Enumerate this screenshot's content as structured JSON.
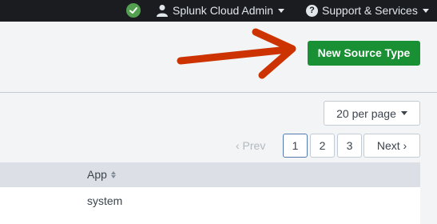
{
  "topbar": {
    "user_label": "Splunk Cloud Admin",
    "support_label": "Support & Services",
    "support_icon_glyph": "?",
    "status_color": "#53a051"
  },
  "header": {
    "new_source_type_label": "New Source Type",
    "button_color": "#1a9035"
  },
  "controls": {
    "per_page_label": "20 per page"
  },
  "pager": {
    "prev_label": "‹ Prev",
    "pages": [
      "1",
      "2",
      "3"
    ],
    "active_page": "1",
    "next_label": "Next ›"
  },
  "table": {
    "columns": [
      "App"
    ],
    "rows": [
      {
        "app": "system"
      }
    ]
  },
  "annotation": {
    "arrow_color": "#cc3300"
  }
}
